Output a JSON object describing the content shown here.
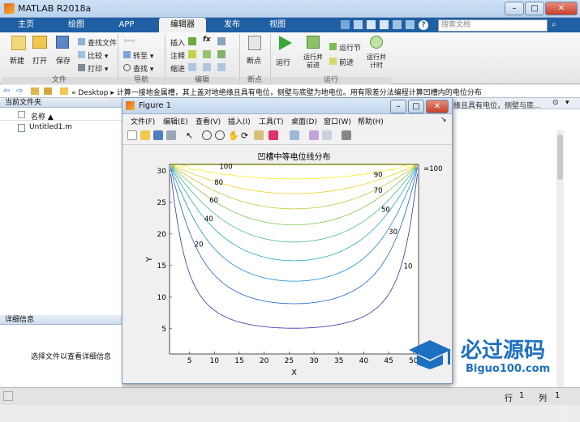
{
  "window": {
    "title": "MATLAB R2018a",
    "min": "–",
    "max": "□",
    "close": "✕"
  },
  "tabs": [
    {
      "label": "主页"
    },
    {
      "label": "绘图"
    },
    {
      "label": "APP"
    },
    {
      "label": "编辑器"
    },
    {
      "label": "发布"
    },
    {
      "label": "视图"
    }
  ],
  "search": {
    "placeholder": "搜索文档"
  },
  "ribbon": {
    "new": "新建",
    "open": "打开",
    "save": "保存",
    "find_files": "查找文件",
    "compare": "比较",
    "print": "打印",
    "goto": "转至",
    "find": "查找",
    "insert": "插入",
    "comment": "注释",
    "indent": "缩进",
    "fx": "fx",
    "breakpoints": "断点",
    "run": "运行",
    "run_advance": "运行并前进",
    "run_section": "运行节",
    "advance": "前进",
    "run_time": "运行并计时",
    "group_file": "文件",
    "group_nav": "导航",
    "group_edit": "编辑",
    "group_bp": "断点",
    "group_run": "运行"
  },
  "address": {
    "path": "« Desktop ▸ 计算一接地金属槽，其上盖对地绝缘且具有电位，侧壁与底壁为地电位。用有限差分法编程计算凹槽内的电位分布",
    "right_text": "缘且具有电位，侧壁与底..."
  },
  "left_panel": {
    "header": "当前文件夹",
    "col_name": "名称 ▲",
    "files": [
      {
        "name": "Untitled1.m"
      }
    ],
    "details_header": "详细信息",
    "details_text": "选择文件以查看详细信息"
  },
  "figure": {
    "title": "Figure 1",
    "menus": [
      "文件(F)",
      "编辑(E)",
      "查看(V)",
      "插入(I)",
      "工具(T)",
      "桌面(D)",
      "窗口(W)",
      "帮助(H)"
    ]
  },
  "status": {
    "row_label": "行",
    "row": "1",
    "col_label": "列",
    "col": "1"
  },
  "watermark": {
    "title": "必过源码",
    "url": "Biguo100.com"
  },
  "chart_data": {
    "type": "contour",
    "title": "凹槽中等电位线分布",
    "xlabel": "X",
    "ylabel": "Y",
    "xlim": [
      1,
      51
    ],
    "ylim": [
      1,
      31
    ],
    "xticks": [
      5,
      10,
      15,
      20,
      25,
      30,
      35,
      40,
      45,
      50
    ],
    "yticks": [
      5,
      10,
      15,
      20,
      25,
      30
    ],
    "levels": [
      10,
      20,
      30,
      40,
      50,
      60,
      70,
      80,
      90,
      100
    ],
    "contour_labels": [
      {
        "text": "100",
        "x": 11,
        "y": 30.3
      },
      {
        "text": "80",
        "x": 10,
        "y": 27.8
      },
      {
        "text": "60",
        "x": 9,
        "y": 25
      },
      {
        "text": "40",
        "x": 8,
        "y": 22
      },
      {
        "text": "20",
        "x": 6,
        "y": 18
      },
      {
        "text": "90",
        "x": 42,
        "y": 29
      },
      {
        "text": "70",
        "x": 42,
        "y": 26.5
      },
      {
        "text": "50",
        "x": 43.5,
        "y": 23.5
      },
      {
        "text": "30",
        "x": 45,
        "y": 20
      },
      {
        "text": "10",
        "x": 48,
        "y": 14.5
      },
      {
        "text": "=100",
        "x": 52,
        "y": 30
      }
    ],
    "grid": false,
    "colormap": "parula"
  }
}
